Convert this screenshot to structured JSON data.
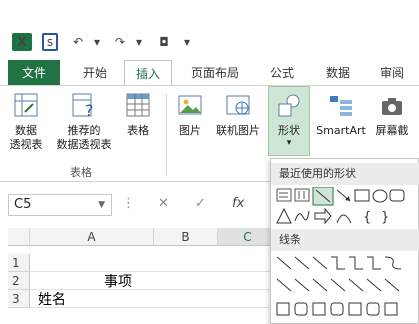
{
  "qat": {
    "app_icon_label": "X",
    "undo_glyph": "↶",
    "redo_glyph": "↷",
    "camera_glyph": "◘",
    "more_glyph": "▾"
  },
  "tabs": [
    {
      "label": "文件"
    },
    {
      "label": "开始"
    },
    {
      "label": "插入"
    },
    {
      "label": "页面布局"
    },
    {
      "label": "公式"
    },
    {
      "label": "数据"
    },
    {
      "label": "审阅"
    }
  ],
  "ribbon": {
    "pivot_table": "数据\n透视表",
    "recommended_pivot": "推荐的\n数据透视表",
    "table": "表格",
    "tables_group": "表格",
    "pictures": "图片",
    "online_pictures": "联机图片",
    "shapes": "形状",
    "shapes_arrow": "▾",
    "smartart": "SmartArt",
    "screenshot": "屏幕截"
  },
  "formula_bar": {
    "name_box": "C5",
    "cancel_glyph": "✕",
    "enter_glyph": "✓",
    "fx_glyph": "fx"
  },
  "grid": {
    "columns": [
      "A",
      "B",
      "C"
    ],
    "rows": [
      "1",
      "2",
      "3"
    ],
    "cells": {
      "B2": "事项",
      "A3": "姓名"
    }
  },
  "shapes_menu": {
    "recent_heading": "最近使用的形状",
    "lines_heading": "线条"
  },
  "colors": {
    "excel_green": "#217346",
    "shapes_highlight": "#cfe6d7"
  }
}
